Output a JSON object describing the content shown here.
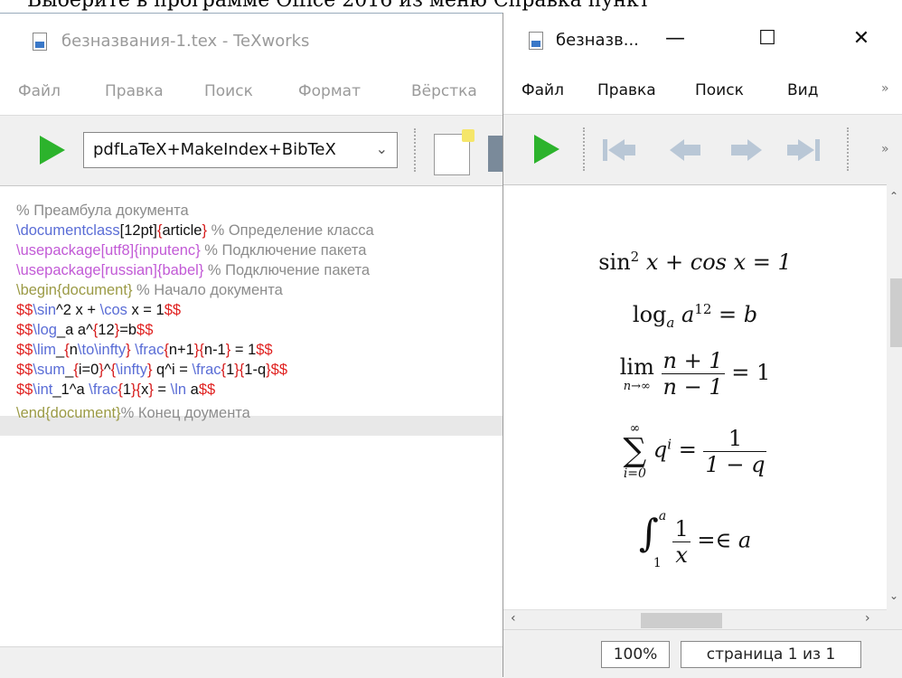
{
  "background_doc": {
    "text": "Выберите в программе Office 2016 из меню Справка пункт"
  },
  "editor": {
    "title": "безназвания-1.tex - TeXworks",
    "menu": [
      "Файл",
      "Правка",
      "Поиск",
      "Формат",
      "Вёрстка"
    ],
    "engine": "pdfLaTeX+MakeIndex+BibTeX",
    "code": {
      "l1": "% Преамбула документа",
      "l2_cmd": "\\documentclass",
      "l2_opt": "[12pt]",
      "l2_b1": "{",
      "l2_arg": "article",
      "l2_b2": "}",
      "l2_cm": " % Определение класса",
      "l3_cmd": "\\usepackage",
      "l3_opt": "[utf8]",
      "l3_b1": "{",
      "l3_arg": "inputenc",
      "l3_b2": "}",
      "l3_cm": " % Подключение пакета",
      "l4_cmd": "\\usepackage",
      "l4_opt": "[russian]",
      "l4_b1": "{",
      "l4_arg": "babel",
      "l4_b2": "}",
      "l4_cm": " % Подключение пакета",
      "l5_cmd": "\\begin",
      "l5_b1": "{",
      "l5_arg": "document",
      "l5_b2": "}",
      "l5_cm": " % Начало документа",
      "l6_d1": "$$",
      "l6_cmd1": "\\sin",
      "l6_t1": "^2 x + ",
      "l6_cmd2": "\\cos",
      "l6_t2": " x = 1",
      "l6_d2": "$$",
      "l7_d1": "$$",
      "l7_cmd1": "\\log",
      "l7_t1": "_a a^",
      "l7_b1": "{",
      "l7_t2": "12",
      "l7_b2": "}",
      "l7_t3": "=b",
      "l7_d2": "$$",
      "l8_d1": "$$",
      "l8_cmd1": "\\lim",
      "l8_t1": "_",
      "l8_b1": "{",
      "l8_t2": "n",
      "l8_cmd2": "\\to",
      "l8_cmd3": "\\infty",
      "l8_b2": "}",
      "l8_t3": " ",
      "l8_cmd4": "\\frac",
      "l8_b3": "{",
      "l8_t4": "n+1",
      "l8_b4": "}{",
      "l8_t5": "n-1",
      "l8_b5": "}",
      "l8_t6": " = 1",
      "l8_d2": "$$",
      "l9_d1": "$$",
      "l9_cmd1": "\\sum",
      "l9_t1": "_",
      "l9_b1": "{",
      "l9_t2": "i=0",
      "l9_b2": "}",
      "l9_t3": "^",
      "l9_b3": "{",
      "l9_cmd2": "\\infty",
      "l9_b4": "}",
      "l9_t4": " q^i = ",
      "l9_cmd3": "\\frac",
      "l9_b5": "{",
      "l9_t5": "1",
      "l9_b6": "}{",
      "l9_t6": "1-q",
      "l9_b7": "}",
      "l9_d2": "$$",
      "l10_d1": "$$",
      "l10_cmd1": "\\int",
      "l10_t1": "_1^a ",
      "l10_cmd2": "\\frac",
      "l10_b1": "{",
      "l10_t2": "1",
      "l10_b2": "}{",
      "l10_t3": "x",
      "l10_b3": "}",
      "l10_t4": " = ",
      "l10_cmd3": "\\ln",
      "l10_t5": " a",
      "l10_d2": "$$",
      "l11_cmd": "\\end",
      "l11_b1": "{",
      "l11_arg": "document",
      "l11_b2": "}",
      "l11_cm": "% Конец доумента"
    }
  },
  "preview": {
    "title": "безназв...",
    "menu": [
      "Файл",
      "Правка",
      "Поиск",
      "Вид"
    ],
    "more": "»",
    "zoom": "100%",
    "page": "страница 1 из 1",
    "formulas": {
      "f1_a": "sin",
      "f1_sup": "2",
      "f1_b": " x + cos x = 1",
      "f2_a": "log",
      "f2_sub": "a",
      "f2_b": " a",
      "f2_sup": "12",
      "f2_c": " = b",
      "f3_lim": "lim",
      "f3_sub": "n→∞",
      "f3_num": "n + 1",
      "f3_den": "n − 1",
      "f3_eq": " = 1",
      "f4_sum": "∑",
      "f4_top": "∞",
      "f4_bot": "i=0",
      "f4_q": "q",
      "f4_sup": "i",
      "f4_eq": " = ",
      "f4_num": "1",
      "f4_den": "1 − q",
      "f5_int": "∫",
      "f5_top": "a",
      "f5_bot": "1",
      "f5_num": "1",
      "f5_den": "x",
      "f5_eq": " =∈ a"
    }
  }
}
